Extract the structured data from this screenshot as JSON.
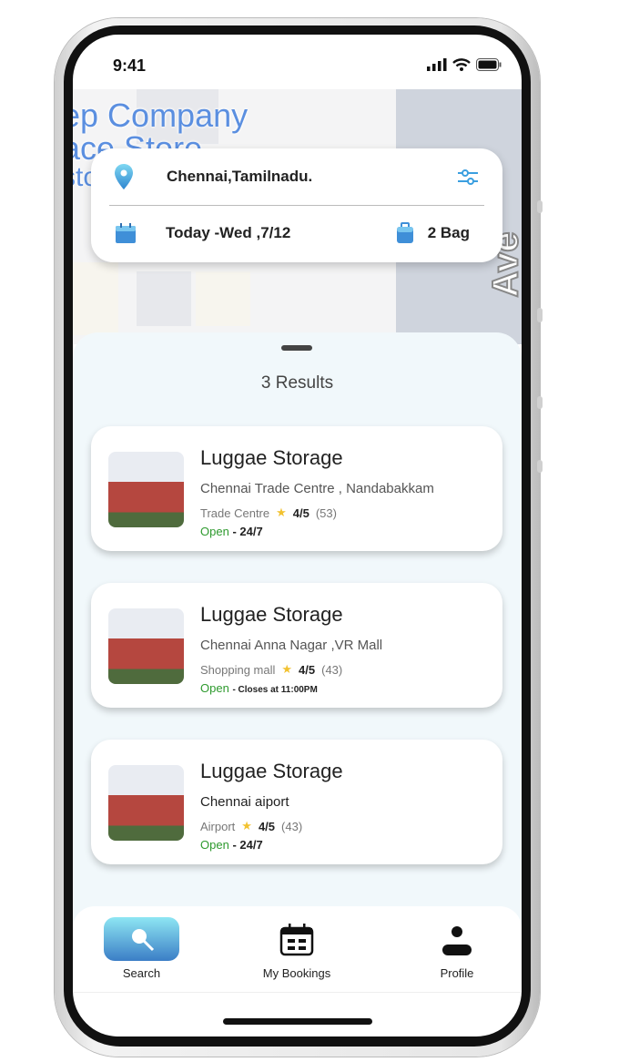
{
  "status_bar": {
    "time": "9:41"
  },
  "map": {
    "labels": [
      "ep Company",
      "ace Store",
      "sto"
    ],
    "street": "Ave"
  },
  "search": {
    "location": "Chennai,Tamilnadu.",
    "date": "Today -Wed ,7/12",
    "bags": "2 Bag",
    "icons": [
      "location-pin-icon",
      "filter-sliders-icon",
      "calendar-icon",
      "luggage-icon"
    ]
  },
  "results": {
    "count_label": "3 Results",
    "items": [
      {
        "title": "Luggae Storage",
        "address": "Chennai Trade Centre , Nandabakkam",
        "category": "Trade Centre",
        "rating": "4/5",
        "reviews": "(53)",
        "status": "Open",
        "hours": "- 24/7"
      },
      {
        "title": "Luggae Storage",
        "address": "Chennai Anna Nagar ,VR Mall",
        "category": "Shopping mall",
        "rating": "4/5",
        "reviews": "(43)",
        "status": "Open",
        "hours": "- Closes at 11:00PM"
      },
      {
        "title": "Luggae Storage",
        "address": "Chennai aiport",
        "category": "Airport",
        "rating": "4/5",
        "reviews": "(43)",
        "status": "Open",
        "hours": "- 24/7"
      }
    ]
  },
  "nav": {
    "search": "Search",
    "bookings": "My Bookings",
    "profile": "Profile"
  },
  "colors": {
    "accent": "#3b9fe0",
    "open": "#2e9a2e",
    "star": "#f2c230",
    "sheet": "#f1f8fb"
  }
}
